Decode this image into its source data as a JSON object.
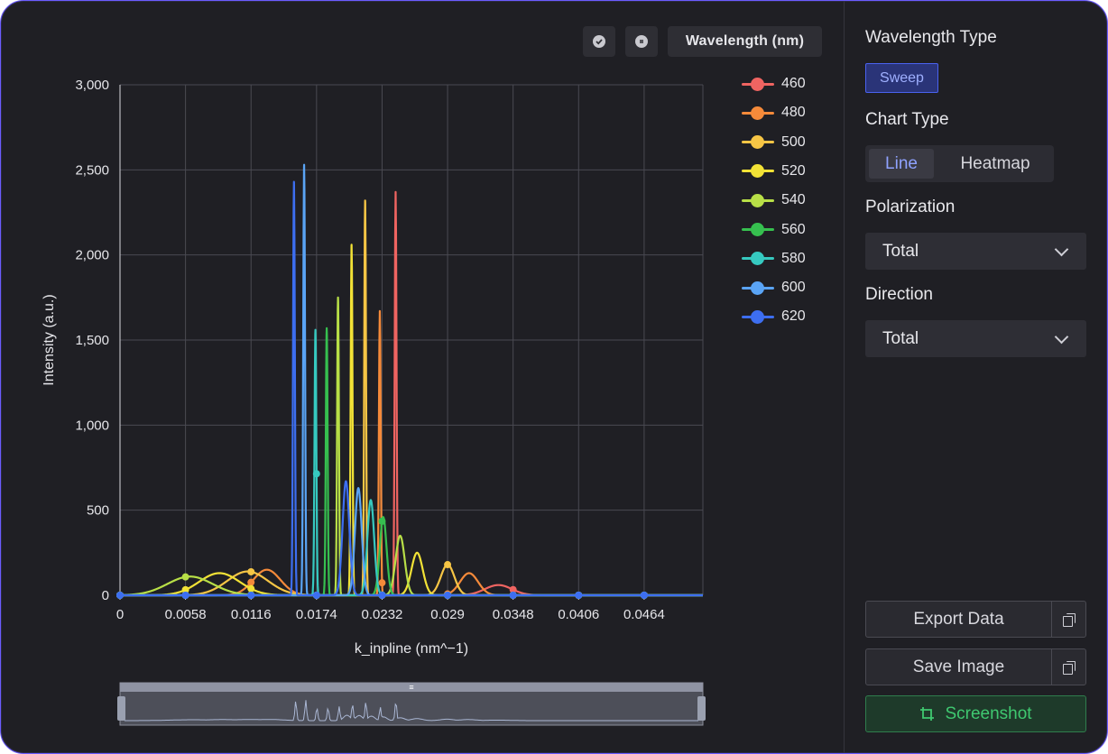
{
  "toolbar": {
    "wavelength_button": "Wavelength (nm)",
    "icon1": "check-circle-icon",
    "icon2": "sort-circle-icon"
  },
  "chart_data": {
    "type": "line",
    "xlabel": "k_inpline (nm^−1)",
    "ylabel": "Intensity (a.u.)",
    "xlim": [
      0,
      0.0516
    ],
    "ylim": [
      0,
      3000
    ],
    "x_ticks": [
      "0",
      "0.0058",
      "0.0116",
      "0.0174",
      "0.0232",
      "0.029",
      "0.0348",
      "0.0406",
      "0.0464"
    ],
    "y_ticks": [
      "0",
      "500",
      "1,000",
      "1,500",
      "2,000",
      "2,500",
      "3,000"
    ],
    "grid": true,
    "legend_position": "right",
    "series": [
      {
        "name": "460",
        "color": "#ef6461",
        "peaks": [
          [
            0.0244,
            2370,
            8e-05
          ],
          [
            0.0335,
            60,
            0.0012
          ]
        ]
      },
      {
        "name": "480",
        "color": "#f58a3a",
        "peaks": [
          [
            0.023,
            1670,
            8e-05
          ],
          [
            0.013,
            150,
            0.0012
          ],
          [
            0.0309,
            130,
            0.0008
          ]
        ]
      },
      {
        "name": "500",
        "color": "#f6c545",
        "peaks": [
          [
            0.0217,
            2320,
            8e-05
          ],
          [
            0.0113,
            140,
            0.0018
          ],
          [
            0.029,
            180,
            0.0006
          ]
        ]
      },
      {
        "name": "520",
        "color": "#f2e236",
        "peaks": [
          [
            0.0205,
            2060,
            8e-05
          ],
          [
            0.0088,
            130,
            0.0018
          ],
          [
            0.0263,
            250,
            0.0005
          ]
        ]
      },
      {
        "name": "540",
        "color": "#b8df47",
        "peaks": [
          [
            0.0193,
            1750,
            8e-05
          ],
          [
            0.0062,
            110,
            0.002
          ],
          [
            0.0248,
            350,
            0.0004
          ]
        ]
      },
      {
        "name": "560",
        "color": "#36bf4f",
        "peaks": [
          [
            0.0183,
            1570,
            8e-05
          ],
          [
            0.0233,
            460,
            0.0003
          ]
        ]
      },
      {
        "name": "580",
        "color": "#36c9c0",
        "peaks": [
          [
            0.0173,
            1560,
            8e-05
          ],
          [
            0.0222,
            560,
            0.0003
          ]
        ]
      },
      {
        "name": "600",
        "color": "#5aa4f5",
        "peaks": [
          [
            0.0163,
            2530,
            8e-05
          ],
          [
            0.0211,
            630,
            0.0003
          ]
        ]
      },
      {
        "name": "620",
        "color": "#3d6ef0",
        "peaks": [
          [
            0.0154,
            2430,
            8e-05
          ],
          [
            0.02,
            670,
            0.0003
          ]
        ]
      }
    ]
  },
  "panel": {
    "wavelength_type_label": "Wavelength Type",
    "sweep_label": "Sweep",
    "chart_type_label": "Chart Type",
    "chart_type_line": "Line",
    "chart_type_heatmap": "Heatmap",
    "polarization_label": "Polarization",
    "polarization_value": "Total",
    "direction_label": "Direction",
    "direction_value": "Total",
    "export_label": "Export Data",
    "save_label": "Save Image",
    "screenshot_label": "Screenshot"
  },
  "slider": {
    "handle_glyph": "≡"
  }
}
